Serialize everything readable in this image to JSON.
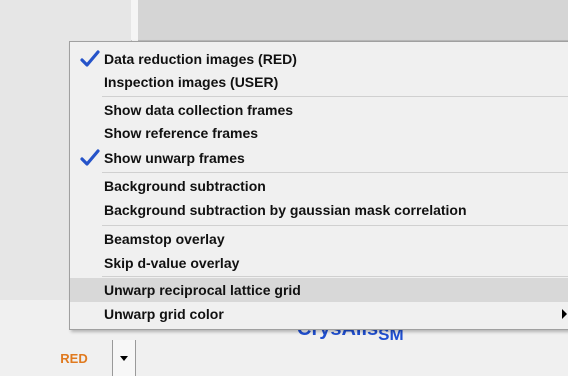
{
  "menu": {
    "items": [
      {
        "label": "Data reduction images (RED)",
        "checked": true
      },
      {
        "label": "Inspection images (USER)",
        "checked": false
      },
      {
        "label": "Show data collection frames",
        "checked": false
      },
      {
        "label": "Show reference frames",
        "checked": false
      },
      {
        "label": "Show unwarp frames",
        "checked": true
      },
      {
        "label": "Background subtraction",
        "checked": false
      },
      {
        "label": "Background subtraction by gaussian mask correlation",
        "checked": false
      },
      {
        "label": "Beamstop overlay",
        "checked": false
      },
      {
        "label": "Skip d-value overlay",
        "checked": false
      },
      {
        "label": "Unwarp reciprocal lattice grid",
        "checked": false,
        "highlighted": true
      },
      {
        "label": "Unwarp grid color",
        "checked": false,
        "submenu": true
      }
    ]
  },
  "bottom": {
    "mode_button": "RED",
    "logo_main": "CrysAlis",
    "logo_sub": "SM"
  },
  "colors": {
    "check": "#2553c9",
    "mode_button_text": "#e07a1f",
    "logo": "#1f4fd1"
  },
  "icons": {
    "check": "check-icon",
    "dropdown": "chevron-down-icon",
    "submenu": "chevron-right-icon"
  }
}
